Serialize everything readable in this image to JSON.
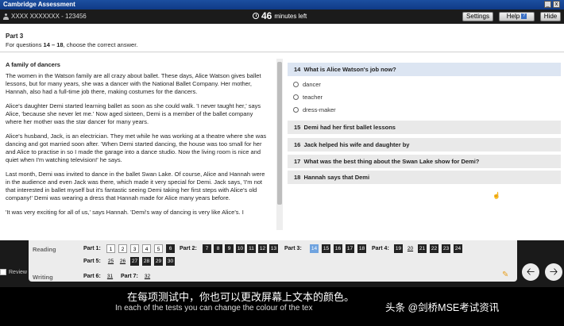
{
  "window": {
    "title": "Cambridge Assessment"
  },
  "header": {
    "candidate": "XXXX XXXXXXX - 123456",
    "timer_value": "46",
    "timer_unit": "minutes left",
    "settings": "Settings",
    "help": "Help",
    "help_mark": "?",
    "hide": "Hide"
  },
  "part": {
    "title": "Part 3",
    "instruction_prefix": "For questions ",
    "instruction_range": "14 – 18",
    "instruction_suffix": ", choose the correct answer."
  },
  "text": {
    "title": "A family of dancers",
    "paragraphs": [
      "The women in the Watson family are all crazy about ballet. These days, Alice Watson gives ballet lessons, but for many years, she was a dancer with the National Ballet Company. Her mother, Hannah, also had a full-time job there, making costumes for the dancers.",
      "Alice's daughter Demi started learning ballet as soon as she could walk. 'I never taught her,' says Alice, 'because she never let me.' Now aged sixteen, Demi is a member of the ballet company where her mother was the star dancer for many years.",
      "Alice's husband, Jack, is an electrician. They met while he was working at a theatre where she was dancing and got married soon after. 'When Demi started dancing, the house was too small for her and Alice to practise in so I made the garage into a dance studio. Now the living room is nice and quiet when I'm watching television!' he says.",
      "Last month, Demi was invited to dance in the ballet Swan Lake. Of course, Alice and Hannah were in the audience and even Jack was there, which made it very special for Demi. Jack says, 'I'm not that interested in ballet myself but it's fantastic seeing Demi taking her first steps with Alice's old company!' Demi was wearing a dress that Hannah made for Alice many years before.",
      "'It was very exciting for all of us,' says Hannah. 'Demi's way of dancing is very like Alice's. I"
    ]
  },
  "questions": [
    {
      "num": "14",
      "text": "What is Alice Watson's job now?",
      "options": [
        "dancer",
        "teacher",
        "dress-maker"
      ]
    },
    {
      "num": "15",
      "text": "Demi had her first ballet lessons"
    },
    {
      "num": "16",
      "text": "Jack helped his wife and daughter by"
    },
    {
      "num": "17",
      "text": "What was the best thing about the Swan Lake show for Demi?"
    },
    {
      "num": "18",
      "text": "Hannah says that Demi"
    }
  ],
  "nav": {
    "reading": "Reading",
    "writing": "Writing",
    "review": "Review",
    "p1": "Part 1:",
    "p2": "Part 2:",
    "p3": "Part 3:",
    "p4": "Part 4:",
    "p5": "Part 5:",
    "p6": "Part 6:",
    "p7": "Part 7:",
    "q": [
      "1",
      "2",
      "3",
      "4",
      "5",
      "6",
      "7",
      "8",
      "9",
      "10",
      "11",
      "12",
      "13",
      "14",
      "15",
      "16",
      "17",
      "18",
      "19",
      "20",
      "21",
      "22",
      "23",
      "24",
      "25",
      "26",
      "27",
      "28",
      "29",
      "30",
      "31",
      "32"
    ]
  },
  "subtitle": {
    "zh": "在每项测试中，你也可以更改屏幕上文本的颜色。",
    "en": "In each of the tests you can change the colour of the tex"
  },
  "watermark": "头条 @剑桥MSE考试资讯"
}
